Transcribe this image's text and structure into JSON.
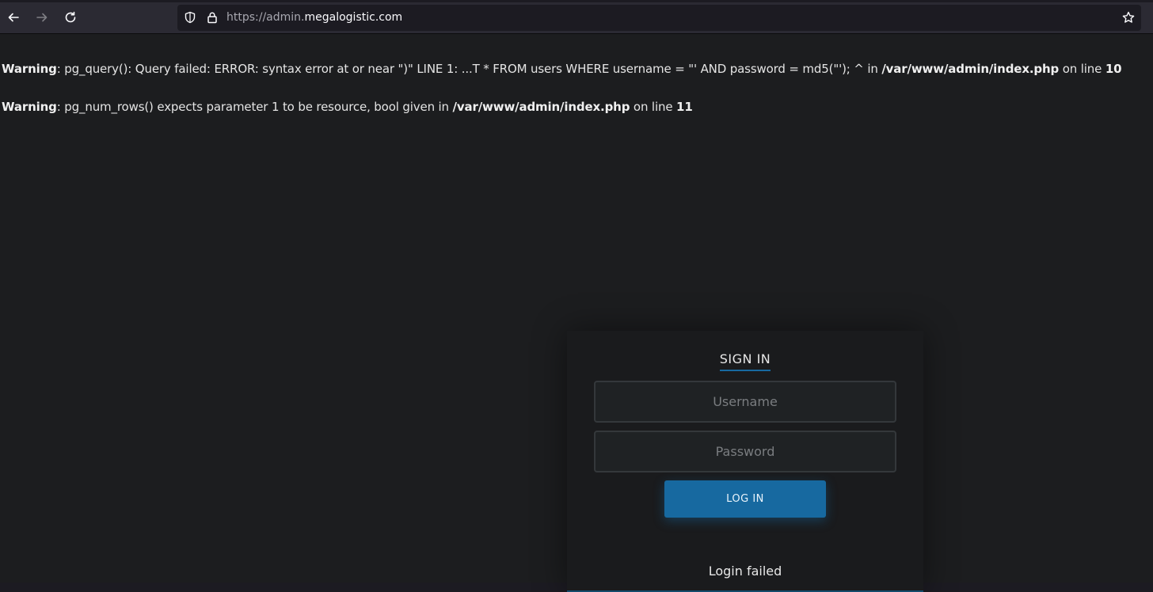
{
  "browser": {
    "url_scheme": "https://admin.",
    "url_domain": "megalogistic.com"
  },
  "warnings": [
    {
      "label": "Warning",
      "message": ": pg_query(): Query failed: ERROR: syntax error at or near \")\" LINE 1: ...T * FROM users WHERE username = \"' AND password = md5(\"'); ^ in ",
      "file": "/var/www/admin/index.php",
      "line_text": " on line ",
      "line": "10"
    },
    {
      "label": "Warning",
      "message": ": pg_num_rows() expects parameter 1 to be resource, bool given in ",
      "file": "/var/www/admin/index.php",
      "line_text": " on line ",
      "line": "11"
    }
  ],
  "login": {
    "title": "SIGN IN",
    "username_placeholder": "Username",
    "password_placeholder": "Password",
    "button_label": "LOG IN",
    "message": "Login failed",
    "accent_color": "#1769a0"
  }
}
